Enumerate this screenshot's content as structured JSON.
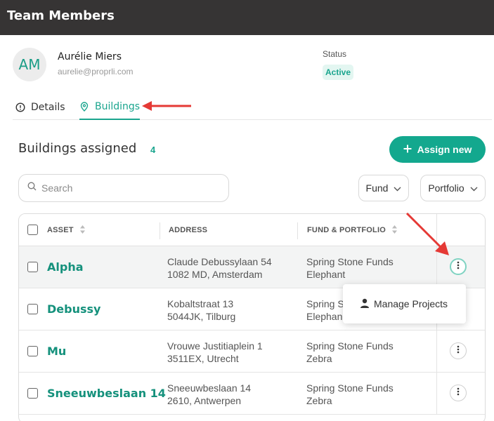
{
  "header": {
    "title": "Team Members"
  },
  "user": {
    "initials": "AM",
    "name": "Aurélie Miers",
    "email": "aurelie@proprli.com",
    "status_label": "Status",
    "status_value": "Active"
  },
  "tabs": [
    {
      "label": "Details",
      "icon": "info-circle-icon"
    },
    {
      "label": "Buildings",
      "icon": "map-pin-icon",
      "active": true
    }
  ],
  "section": {
    "title": "Buildings assigned",
    "count": "4"
  },
  "assign_button": {
    "label": "Assign new"
  },
  "search": {
    "placeholder": "Search"
  },
  "filters": {
    "fund": "Fund",
    "portfolio": "Portfolio"
  },
  "table": {
    "columns": [
      "ASSET",
      "ADDRESS",
      "FUND & PORTFOLIO"
    ],
    "rows": [
      {
        "asset": "Alpha",
        "address_line1": "Claude Debussylaan 54",
        "address_line2": "1082 MD, Amsterdam",
        "fund": "Spring Stone Funds",
        "portfolio": "Elephant"
      },
      {
        "asset": "Debussy",
        "address_line1": "Kobaltstraat 13",
        "address_line2": "5044JK, Tilburg",
        "fund": "Spring S",
        "portfolio": "Elephan"
      },
      {
        "asset": "Mu",
        "address_line1": "Vrouwe Justitiaplein 1",
        "address_line2": "3511EX, Utrecht",
        "fund": "Spring Stone Funds",
        "portfolio": "Zebra"
      },
      {
        "asset": "Sneeuwbeslaan 14",
        "address_line1": "Sneeuwbeslaan 14",
        "address_line2": "2610, Antwerpen",
        "fund": "Spring Stone Funds",
        "portfolio": "Zebra"
      }
    ]
  },
  "dropdown_menu": {
    "item": "Manage Projects",
    "icon": "user-icon"
  },
  "colors": {
    "accent": "#13a88e",
    "header_bg": "#363434",
    "annotation_red": "#e53935"
  }
}
